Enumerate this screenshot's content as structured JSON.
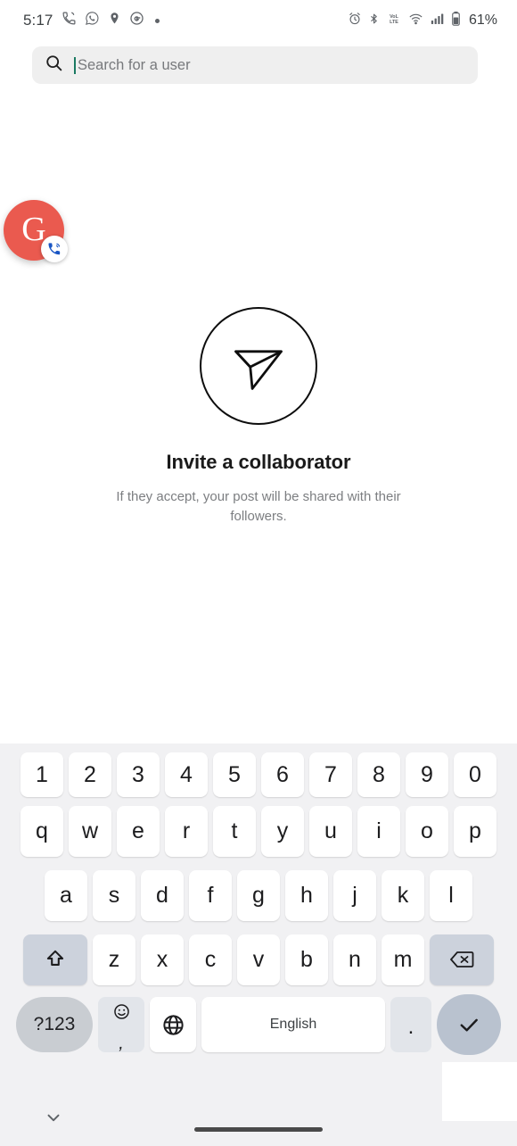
{
  "status_bar": {
    "time": "5:17",
    "battery_percent": "61%",
    "left_icons": [
      "phone-call-icon",
      "whatsapp-icon",
      "location-pin-icon",
      "google-g-icon",
      "dot-indicator-icon"
    ],
    "right_icons": [
      "alarm-clock-icon",
      "bluetooth-icon",
      "volte-icon",
      "wifi-icon",
      "cellular-signal-icon",
      "battery-icon"
    ],
    "volte_label": "VoLTE"
  },
  "search": {
    "placeholder": "Search for a user",
    "value": "",
    "icon": "search-icon",
    "caret_color": "#1a7a62"
  },
  "floating_bubble": {
    "letter": "G",
    "color": "#ea5a4f",
    "badge_icon": "phone-call-icon",
    "badge_color": "#1a56c4"
  },
  "empty_state": {
    "icon": "send-paper-plane-icon",
    "title": "Invite a collaborator",
    "subtitle": "If they accept, your post will be shared with their followers."
  },
  "keyboard": {
    "row_numbers": [
      "1",
      "2",
      "3",
      "4",
      "5",
      "6",
      "7",
      "8",
      "9",
      "0"
    ],
    "row_q": [
      "q",
      "w",
      "e",
      "r",
      "t",
      "y",
      "u",
      "i",
      "o",
      "p"
    ],
    "row_a": [
      "a",
      "s",
      "d",
      "f",
      "g",
      "h",
      "j",
      "k",
      "l"
    ],
    "row_z": [
      "z",
      "x",
      "c",
      "v",
      "b",
      "n",
      "m"
    ],
    "shift_icon": "shift-arrow-icon",
    "backspace_icon": "backspace-icon",
    "symbols_label": "?123",
    "emoji_icon": "emoji-smiley-icon",
    "comma_label": ",",
    "globe_icon": "language-globe-icon",
    "space_label": "English",
    "period_label": ".",
    "enter_icon": "checkmark-icon"
  },
  "nav_bar": {
    "collapse_icon": "chevron-down-icon",
    "home_indicator": "home-gesture-bar"
  }
}
